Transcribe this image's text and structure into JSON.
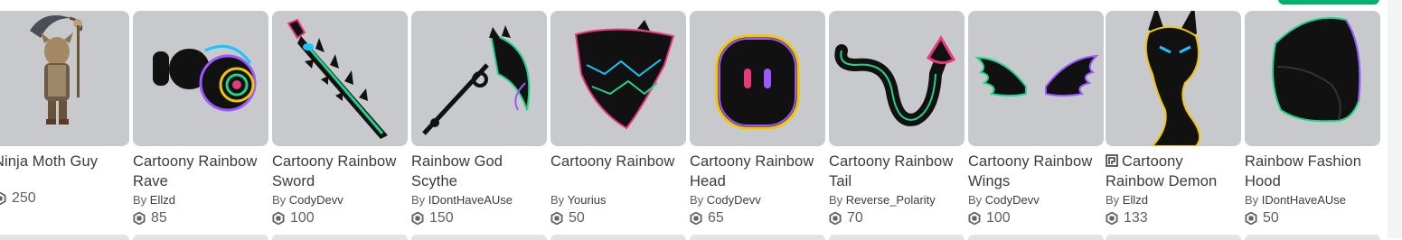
{
  "items": [
    {
      "name": "Ninja Moth Guy",
      "creator_by": "",
      "creator": "",
      "price": "250",
      "icon": "moth-ninja-figure"
    },
    {
      "name": "Cartoony Rainbow Rave",
      "creator_by": "By",
      "creator": "Ellzd",
      "price": "85",
      "icon": "rave-headphones"
    },
    {
      "name": "Cartoony Rainbow Sword",
      "creator_by": "By",
      "creator": "CodyDevv",
      "price": "100",
      "icon": "rainbow-sword"
    },
    {
      "name": "Rainbow God Scythe",
      "creator_by": "By",
      "creator": "IDontHaveAUse",
      "price": "150",
      "icon": "rainbow-scythe"
    },
    {
      "name": "Cartoony Rainbow",
      "creator_by": "By",
      "creator": "Yourius",
      "price": "50",
      "icon": "rainbow-bandana"
    },
    {
      "name": "Cartoony Rainbow Head",
      "creator_by": "By",
      "creator": "CodyDevv",
      "price": "65",
      "icon": "rainbow-head"
    },
    {
      "name": "Cartoony Rainbow Tail",
      "creator_by": "By",
      "creator": "Reverse_Polarity",
      "price": "70",
      "icon": "rainbow-tail"
    },
    {
      "name": "Cartoony Rainbow Wings",
      "creator_by": "By",
      "creator": "CodyDevv",
      "price": "100",
      "icon": "rainbow-wings"
    },
    {
      "name": "Cartoony Rainbow Demon",
      "creator_by": "By",
      "creator": "Ellzd",
      "price": "133",
      "icon": "rainbow-demon",
      "limited_icon": "limited-badge-icon"
    },
    {
      "name": "Rainbow Fashion Hood",
      "creator_by": "By",
      "creator": "IDontHaveAUse",
      "price": "50",
      "icon": "rainbow-hood"
    }
  ],
  "colors": {
    "thumb_bg": "#c8c9cc",
    "accent_green": "#00b06f"
  }
}
